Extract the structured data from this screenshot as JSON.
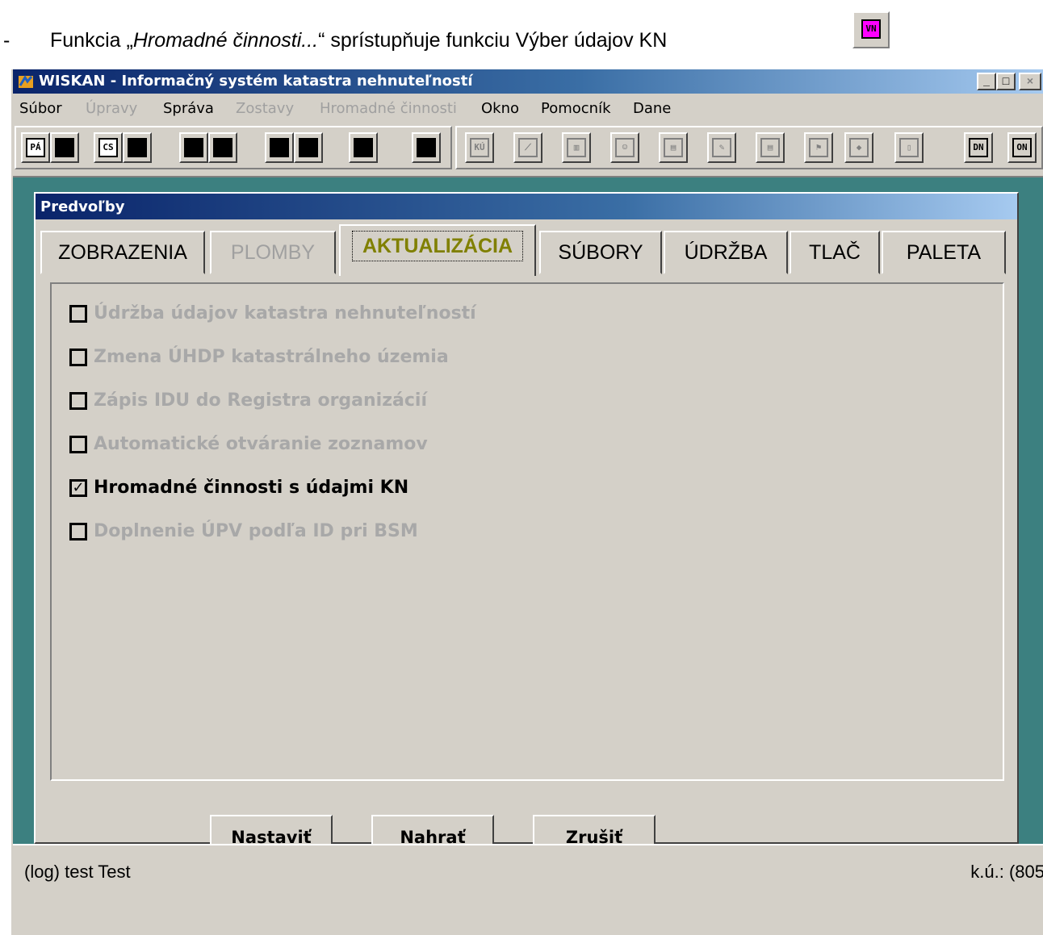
{
  "caption": {
    "dash": "-",
    "prefix": "Funkcia „",
    "italic": "Hromadné činnosti...",
    "suffix": "“ sprístupňuje funkciu Výber údajov KN",
    "icon_label": "VN",
    "icon_color": "#ff00ff"
  },
  "window": {
    "title": "WISKAN - Informačný systém katastra nehnuteľností",
    "minimize": "_",
    "maximize": "□",
    "close": "×"
  },
  "menu": [
    {
      "label": "Súbor",
      "enabled": true
    },
    {
      "label": "Úpravy",
      "enabled": false
    },
    {
      "label": "Správa",
      "enabled": true
    },
    {
      "label": "Zostavy",
      "enabled": false
    },
    {
      "label": "Hromadné činnosti",
      "enabled": false
    },
    {
      "label": "Okno",
      "enabled": true
    },
    {
      "label": "Pomocník",
      "enabled": true
    },
    {
      "label": "Dane",
      "enabled": true
    }
  ],
  "toolbar": {
    "pa": "PÁ",
    "cs": "CS",
    "ku": "KÚ",
    "dn": "DN",
    "on": "ON"
  },
  "dialog": {
    "title": "Predvoľby",
    "tabs": [
      {
        "label": "ZOBRAZENIA",
        "enabled": true,
        "active": false
      },
      {
        "label": "PLOMBY",
        "enabled": false,
        "active": false
      },
      {
        "label": "AKTUALIZÁCIA",
        "enabled": true,
        "active": true
      },
      {
        "label": "SÚBORY",
        "enabled": true,
        "active": false
      },
      {
        "label": "ÚDRŽBA",
        "enabled": true,
        "active": false
      },
      {
        "label": "TLAČ",
        "enabled": true,
        "active": false
      },
      {
        "label": "PALETA",
        "enabled": true,
        "active": false
      }
    ],
    "options": [
      {
        "label": "Údržba údajov katastra nehnuteľností",
        "checked": false,
        "enabled": false
      },
      {
        "label": "Zmena ÚHDP katastrálneho územia",
        "checked": false,
        "enabled": false
      },
      {
        "label": "Zápis IDU do Registra organizácií",
        "checked": false,
        "enabled": false
      },
      {
        "label": "Automatické otváranie zoznamov",
        "checked": false,
        "enabled": false
      },
      {
        "label": "Hromadné činnosti s údajmi KN",
        "checked": true,
        "enabled": true
      },
      {
        "label": "Doplnenie ÚPV podľa ID pri BSM",
        "checked": false,
        "enabled": false
      }
    ],
    "buttons": {
      "set": "Nastaviť",
      "load": "Nahrať",
      "cancel": "Zrušiť"
    }
  },
  "status": {
    "left": "(log)  test Test",
    "right": "k.ú.: (805"
  },
  "colors": {
    "title_start": "#0a246a",
    "title_end": "#a6caf0",
    "client_bg": "#3c8080",
    "face": "#d4d0c8",
    "active_tab_text": "#808000"
  }
}
